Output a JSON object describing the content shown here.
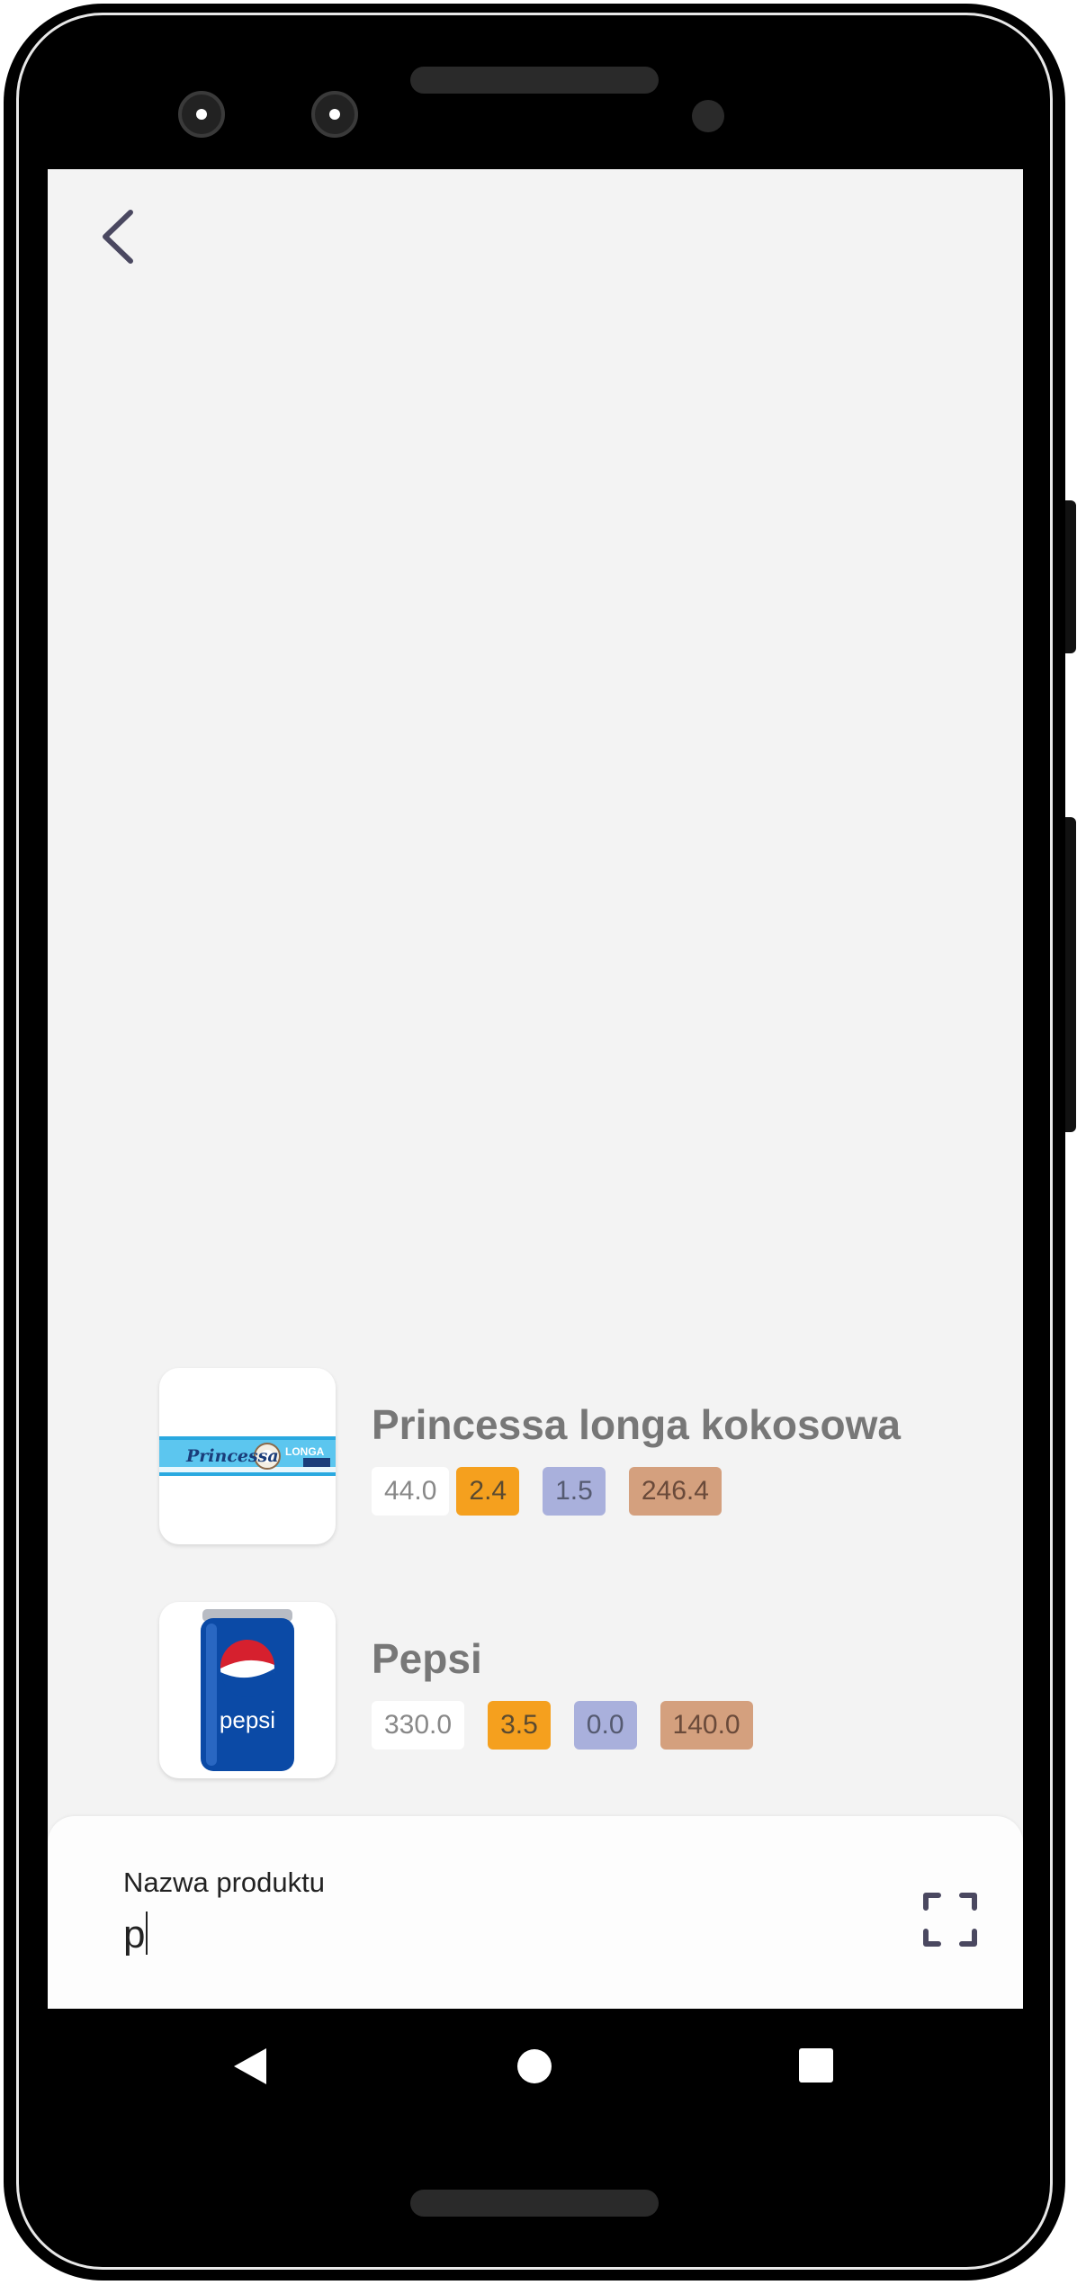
{
  "header": {
    "back_icon": "chevron-left-icon"
  },
  "products": [
    {
      "name": "Princessa longa kokosowa",
      "image": "princessa-wafer-image",
      "values": [
        "44.0",
        "2.4",
        "1.5",
        "246.4"
      ]
    },
    {
      "name": "Pepsi",
      "image": "pepsi-can-image",
      "values": [
        "330.0",
        "3.5",
        "0.0",
        "140.0"
      ]
    }
  ],
  "search": {
    "label": "Nazwa produktu",
    "value": "p",
    "scan_icon": "scan-frame-icon"
  },
  "colors": {
    "chip_white": "#ffffff",
    "chip_orange": "#f5a01e",
    "chip_lavender": "#a9b0dc",
    "chip_tan": "#d4a07e",
    "screen_background": "#f3f3f3",
    "icon": "#4a4860"
  },
  "system_nav": {
    "back": "triangle-back-icon",
    "home": "circle-home-icon",
    "recents": "square-recents-icon"
  },
  "logos": {
    "princessa": "Princessa",
    "longa": "LONGA",
    "pepsi": "pepsi"
  }
}
